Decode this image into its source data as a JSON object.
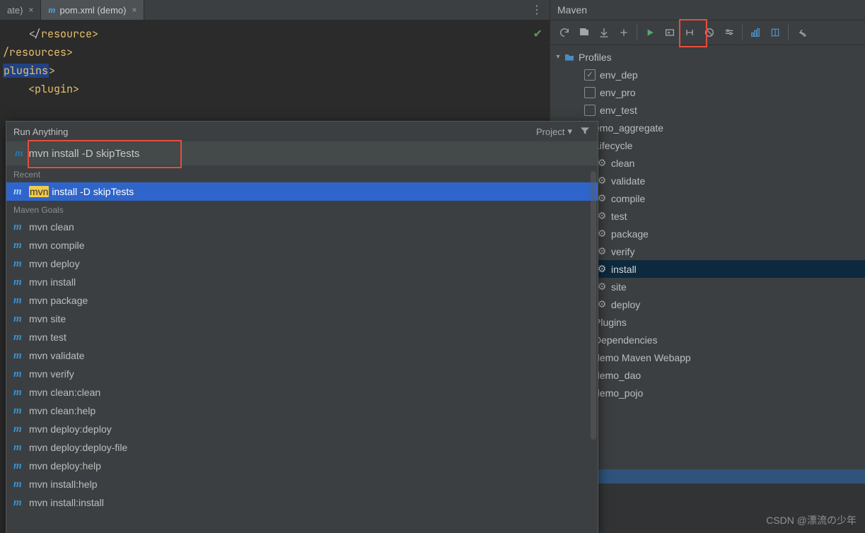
{
  "tabs": {
    "left_tab_fragment": "ate)",
    "active_tab": "pom.xml (demo)"
  },
  "editor": {
    "line1_pre": "    </",
    "line1_tag": "resource",
    "line1_post": ">",
    "line2_pre": "/",
    "line2_tag": "resources",
    "line2_post": ">",
    "line3_tag": "plugins",
    "line3_post": ">",
    "line4_pre": "    <",
    "line4_tag": "plugin",
    "line4_post": ">"
  },
  "popup": {
    "title": "Run Anything",
    "project_label": "Project",
    "input_value": "mvn install -D skipTests",
    "section_recent": "Recent",
    "section_goals": "Maven Goals",
    "recent": {
      "prefix": "mvn",
      "rest": " install -D skipTests"
    },
    "goals": [
      "mvn clean",
      "mvn compile",
      "mvn deploy",
      "mvn install",
      "mvn package",
      "mvn site",
      "mvn test",
      "mvn validate",
      "mvn verify",
      "mvn clean:clean",
      "mvn clean:help",
      "mvn deploy:deploy",
      "mvn deploy:deploy-file",
      "mvn deploy:help",
      "mvn install:help",
      "mvn install:install"
    ]
  },
  "maven": {
    "panel_title": "Maven",
    "tree": {
      "profiles": "Profiles",
      "env_dep": "env_dep",
      "env_pro": "env_pro",
      "env_test": "env_test",
      "aggregate": "emo_aggregate",
      "lifecycle": "Lifecycle",
      "phases": [
        "clean",
        "validate",
        "compile",
        "test",
        "package",
        "verify",
        "install",
        "site",
        "deploy"
      ],
      "plugins": "Plugins",
      "dependencies": "Dependencies",
      "mod1": "demo Maven Webapp",
      "mod2": "demo_dao",
      "mod3": "demo_pojo"
    }
  },
  "watermark": "CSDN @漂流の少年"
}
